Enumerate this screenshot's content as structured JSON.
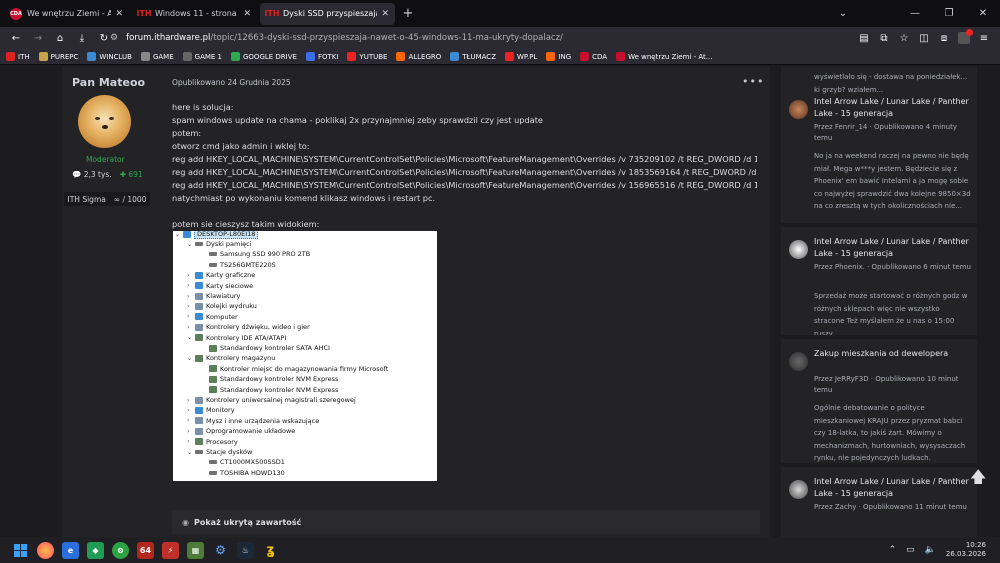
{
  "tabs": [
    {
      "label": "We wnętrzu Ziemi - At the E",
      "favicon": "CDA"
    },
    {
      "label": "Windows 11 - strona 45 - Wind",
      "favicon": "ITH"
    },
    {
      "label": "Dyski SSD przyspieszają nawet",
      "favicon": "ITH",
      "active": true
    }
  ],
  "url": {
    "host": "forum.ithardware.pl",
    "path": "/topic/12663-dyski-ssd-przyspieszaja-nawet-o-45-windows-11-ma-ukryty-dopalacz/"
  },
  "bookmarks": [
    {
      "label": "ITH",
      "color": "#d22"
    },
    {
      "label": "PUREPC",
      "color": "#c6a34a"
    },
    {
      "label": "WINCLUB",
      "color": "#3a8ad6"
    },
    {
      "label": "GAME",
      "color": "#888"
    },
    {
      "label": "GAME 1",
      "color": "#666"
    },
    {
      "label": "GOOGLE DRIVE",
      "color": "#2fa84f"
    },
    {
      "label": "FOTKI",
      "color": "#3a6ee8"
    },
    {
      "label": "YUTUBE",
      "color": "#e22"
    },
    {
      "label": "ALLEGRO",
      "color": "#f60"
    },
    {
      "label": "TŁUMACZ",
      "color": "#3a8ad6"
    },
    {
      "label": "WP.PL",
      "color": "#e22"
    },
    {
      "label": "ING",
      "color": "#f60"
    },
    {
      "label": "CDA",
      "color": "#c8102e"
    },
    {
      "label": "We wnętrzu Ziemi - At...",
      "color": "#c8102e"
    }
  ],
  "author": {
    "name": "Pan Mateoo",
    "role": "Moderator",
    "posts": "2,3 tys.",
    "reputation": "691",
    "badge": "ITH Sigma",
    "badge_value": "∞ / 1000"
  },
  "post": {
    "meta": "Opublikowano 24 Grudnia 2025",
    "lines": [
      "here is solucja:",
      "spam windows update na chama - poklikaj 2x przynajmniej zeby sprawdzil czy jest update",
      "potem:",
      "otworz cmd jako admin i wklej to:",
      "reg add HKEY_LOCAL_MACHINE\\SYSTEM\\CurrentControlSet\\Policies\\Microsoft\\FeatureManagement\\Overrides /v 735209102 /t REG_DWORD /d 1 /f",
      "reg add HKEY_LOCAL_MACHINE\\SYSTEM\\CurrentControlSet\\Policies\\Microsoft\\FeatureManagement\\Overrides /v 1853569164 /t REG_DWORD /d 1 /f",
      "reg add HKEY_LOCAL_MACHINE\\SYSTEM\\CurrentControlSet\\Policies\\Microsoft\\FeatureManagement\\Overrides /v 156965516 /t REG_DWORD /d 1 /f",
      "natychmiast po wykonaniu komend klikasz windows i restart pc.",
      "",
      "potem sie cieszysz takim widokiem:"
    ],
    "hidden_content": "Pokaż ukrytą zawartość"
  },
  "device_manager": {
    "root": "DESKTOP-L80EI18",
    "rows": [
      {
        "label": "Dyski pamięci",
        "level": 1,
        "expanded": true,
        "icon": "disk"
      },
      {
        "label": "Samsung SSD 990 PRO 2TB",
        "level": 2,
        "icon": "disk"
      },
      {
        "label": "TS256GMTE220S",
        "level": 2,
        "icon": "disk"
      },
      {
        "label": "Karty graficzne",
        "level": 1,
        "icon": "mon"
      },
      {
        "label": "Karty sieciowe",
        "level": 1,
        "icon": "mon"
      },
      {
        "label": "Klawiatury",
        "level": 1,
        "icon": "gen"
      },
      {
        "label": "Kolejki wydruku",
        "level": 1,
        "icon": "gen"
      },
      {
        "label": "Komputer",
        "level": 1,
        "icon": "mon"
      },
      {
        "label": "Kontrolery dźwięku, wideo i gier",
        "level": 1,
        "icon": "gen"
      },
      {
        "label": "Kontrolery IDE ATA/ATAPI",
        "level": 1,
        "expanded": true,
        "icon": "ctl"
      },
      {
        "label": "Standardowy kontroler SATA AHCI",
        "level": 2,
        "icon": "ctl"
      },
      {
        "label": "Kontrolery magazynu",
        "level": 1,
        "expanded": true,
        "icon": "ctl"
      },
      {
        "label": "Kontroler miejsc do magazynowania firmy Microsoft",
        "level": 2,
        "icon": "ctl"
      },
      {
        "label": "Standardowy kontroler NVM Express",
        "level": 2,
        "icon": "ctl"
      },
      {
        "label": "Standardowy kontroler NVM Express",
        "level": 2,
        "icon": "ctl"
      },
      {
        "label": "Kontrolery uniwersalnej magistrali szeregowej",
        "level": 1,
        "icon": "gen"
      },
      {
        "label": "Monitory",
        "level": 1,
        "icon": "mon"
      },
      {
        "label": "Mysz i inne urządzenia wskazujące",
        "level": 1,
        "icon": "gen"
      },
      {
        "label": "Oprogramowanie układowe",
        "level": 1,
        "icon": "gen"
      },
      {
        "label": "Procesory",
        "level": 1,
        "icon": "ctl"
      },
      {
        "label": "Stacje dysków",
        "level": 1,
        "expanded": true,
        "icon": "disk"
      },
      {
        "label": "CT1000MX500SSD1",
        "level": 2,
        "icon": "disk"
      },
      {
        "label": "TOSHIBA HDWD130",
        "level": 2,
        "icon": "disk"
      }
    ]
  },
  "sidebar": {
    "top_fragment": "wyświetlało się - dostawa na poniedziałek... ki grzyb?   wziałem...",
    "items": [
      {
        "title": "Intel Arrow Lake / Lunar Lake / Panther Lake - 15 generacja",
        "meta": "Przez Fenrir_14 · Opublikowano 4 minuty temu",
        "text": "No ja na weekend raczej na pewno nie będę miał. Mega w***y jestem. Będziecie się z Phoenix' em bawić Intelami a ja mogę sobie co najwyżej sprawdzić dwa kolejne 9850×3d na co zresztą w tych okolicznościach nie..."
      },
      {
        "title": "Intel Arrow Lake / Lunar Lake / Panther Lake - 15 generacja",
        "meta": "Przez Phoenix. · Opublikowano 6 minut temu",
        "text": "Sprzedaż może startować o różnych godz w różnych sklepach więc nie wszystko stracone   Też myślałem że u nas o 15:00 ruszy."
      },
      {
        "title": "Zakup mieszkania od dewelopera",
        "meta": "Przez JeRRyF3D · Opublikowano 10 minut temu",
        "text": "Ogólnie debatowanie o polityce mieszkaniowej KRAJU przez pryzmat babci czy 18-latka, to jakiś żart. Mówimy o mechanizmach, hurtowniach, wysysaczach rynku, nie pojedynczych ludkach."
      },
      {
        "title": "Intel Arrow Lake / Lunar Lake / Panther Lake - 15 generacja",
        "meta": "Przez Zachy · Opublikowano 11 minut temu",
        "text": ""
      }
    ]
  },
  "taskbar": {
    "time": "10:26",
    "date": "26.03.2026"
  }
}
